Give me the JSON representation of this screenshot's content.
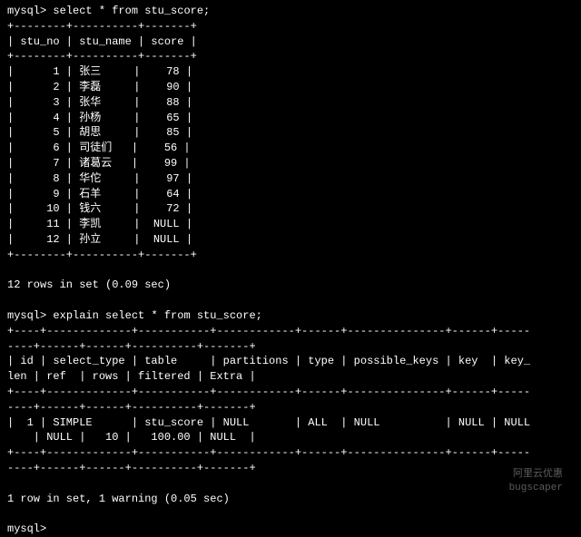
{
  "query1": {
    "prompt": "mysql> ",
    "command": "select * from stu_score;",
    "border_top": "+--------+----------+-------+",
    "header": "| stu_no | stu_name | score |",
    "border_mid": "+--------+----------+-------+",
    "rows": [
      "|      1 | 张三     |    78 |",
      "|      2 | 李磊     |    90 |",
      "|      3 | 张华     |    88 |",
      "|      4 | 孙杨     |    65 |",
      "|      5 | 胡思     |    85 |",
      "|      6 | 司徒们   |    56 |",
      "|      7 | 诸葛云   |    99 |",
      "|      8 | 华佗     |    97 |",
      "|      9 | 石羊     |    64 |",
      "|     10 | 钱六     |    72 |",
      "|     11 | 李凯     |  NULL |",
      "|     12 | 孙立     |  NULL |"
    ],
    "border_bot": "+--------+----------+-------+",
    "status": "12 rows in set (0.09 sec)"
  },
  "query2": {
    "prompt": "mysql> ",
    "command": "explain select * from stu_score;",
    "border_top": "+----+-------------+-----------+------------+------+---------------+------+-----",
    "border_top2": "----+------+------+----------+-------+",
    "header1": "| id | select_type | table     | partitions | type | possible_keys | key  | key_",
    "header2": "len | ref  | rows | filtered | Extra |",
    "border_mid": "+----+-------------+-----------+------------+------+---------------+------+-----",
    "border_mid2": "----+------+------+----------+-------+",
    "row1": "|  1 | SIMPLE      | stu_score | NULL       | ALL  | NULL          | NULL | NULL",
    "row2": "    | NULL |   10 |   100.00 | NULL  |",
    "border_bot": "+----+-------------+-----------+------------+------+---------------+------+-----",
    "border_bot2": "----+------+------+----------+-------+",
    "status": "1 row in set, 1 warning (0.05 sec)"
  },
  "final_prompt": "mysql> ",
  "watermark1": "阿里云优惠",
  "watermark2": "bugscaper"
}
